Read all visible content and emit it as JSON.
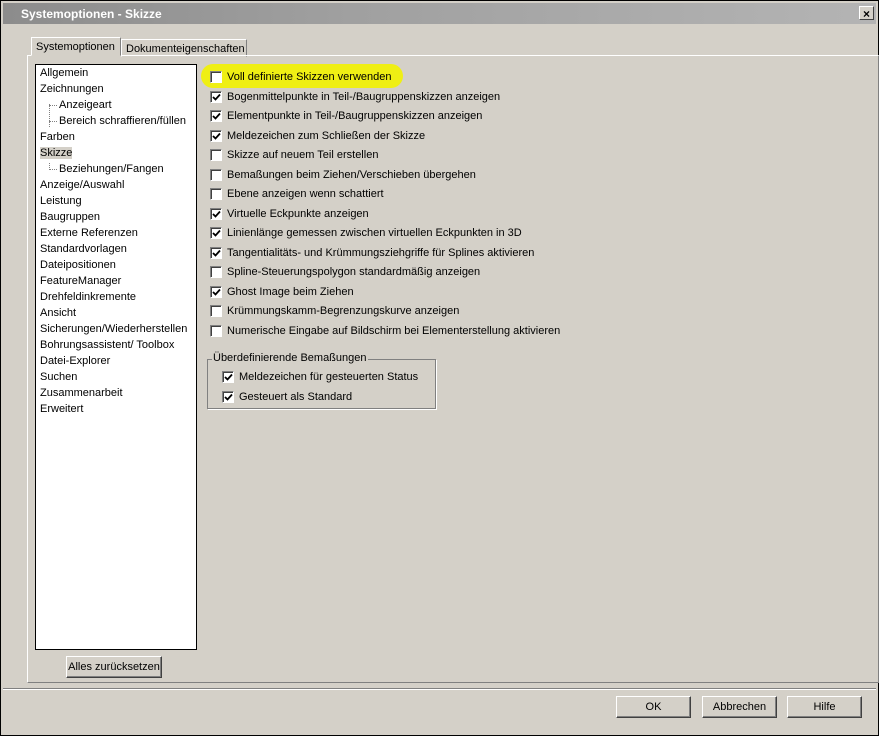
{
  "window": {
    "title": "Systemoptionen - Skizze",
    "close_glyph": "×"
  },
  "tabs": [
    {
      "label": "Systemoptionen",
      "active": true
    },
    {
      "label": "Dokumenteigenschaften",
      "active": false
    }
  ],
  "tree": {
    "items": [
      {
        "label": "Allgemein",
        "level": 0
      },
      {
        "label": "Zeichnungen",
        "level": 0
      },
      {
        "label": "Anzeigeart",
        "level": 1
      },
      {
        "label": "Bereich schraffieren/füllen",
        "level": 1
      },
      {
        "label": "Farben",
        "level": 0
      },
      {
        "label": "Skizze",
        "level": 0,
        "selected": true
      },
      {
        "label": "Beziehungen/Fangen",
        "level": 1
      },
      {
        "label": "Anzeige/Auswahl",
        "level": 0
      },
      {
        "label": "Leistung",
        "level": 0
      },
      {
        "label": "Baugruppen",
        "level": 0
      },
      {
        "label": "Externe Referenzen",
        "level": 0
      },
      {
        "label": "Standardvorlagen",
        "level": 0
      },
      {
        "label": "Dateipositionen",
        "level": 0
      },
      {
        "label": "FeatureManager",
        "level": 0
      },
      {
        "label": "Drehfeldinkremente",
        "level": 0
      },
      {
        "label": "Ansicht",
        "level": 0
      },
      {
        "label": "Sicherungen/Wiederherstellen",
        "level": 0
      },
      {
        "label": "Bohrungsassistent/ Toolbox",
        "level": 0
      },
      {
        "label": "Datei-Explorer",
        "level": 0
      },
      {
        "label": "Suchen",
        "level": 0
      },
      {
        "label": "Zusammenarbeit",
        "level": 0
      },
      {
        "label": "Erweitert",
        "level": 0
      }
    ],
    "reset_label": "Alles zurücksetzen"
  },
  "options": [
    {
      "label": "Voll definierte Skizzen verwenden",
      "checked": false,
      "highlighted": true
    },
    {
      "label": "Bogenmittelpunkte in Teil-/Baugruppenskizzen anzeigen",
      "checked": true
    },
    {
      "label": "Elementpunkte in Teil-/Baugruppenskizzen anzeigen",
      "checked": true
    },
    {
      "label": "Meldezeichen zum Schließen der Skizze",
      "checked": true
    },
    {
      "label": "Skizze auf neuem Teil erstellen",
      "checked": false
    },
    {
      "label": "Bemaßungen beim Ziehen/Verschieben übergehen",
      "checked": false
    },
    {
      "label": "Ebene anzeigen wenn schattiert",
      "checked": false
    },
    {
      "label": "Virtuelle Eckpunkte anzeigen",
      "checked": true
    },
    {
      "label": "Linienlänge gemessen zwischen virtuellen Eckpunkten in 3D",
      "checked": true
    },
    {
      "label": "Tangentialitäts- und Krümmungsziehgriffe für Splines aktivieren",
      "checked": true
    },
    {
      "label": "Spline-Steuerungspolygon standardmäßig anzeigen",
      "checked": false
    },
    {
      "label": "Ghost Image beim Ziehen",
      "checked": true
    },
    {
      "label": "Krümmungskamm-Begrenzungskurve anzeigen",
      "checked": false
    },
    {
      "label": "Numerische Eingabe auf Bildschirm bei Elementerstellung aktivieren",
      "checked": false
    }
  ],
  "group": {
    "title": "Überdefinierende Bemaßungen",
    "options": [
      {
        "label": "Meldezeichen für gesteuerten Status",
        "checked": true
      },
      {
        "label": "Gesteuert als Standard",
        "checked": true
      }
    ]
  },
  "buttons": {
    "ok": "OK",
    "cancel": "Abbrechen",
    "help": "Hilfe"
  },
  "colors": {
    "highlight": "#f2f200",
    "window_bg": "#d4d0c8"
  }
}
